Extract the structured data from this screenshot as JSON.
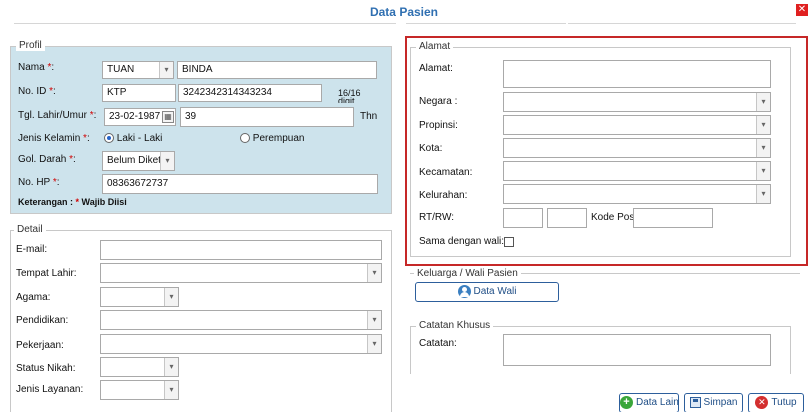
{
  "window": {
    "title": "Data Pasien"
  },
  "profil": {
    "legend": "Profil",
    "nama": {
      "label": "Nama",
      "gelar": "TUAN",
      "value": "BINDA"
    },
    "no_id": {
      "label": "No. ID",
      "type": "KTP",
      "value": "3242342314343234",
      "counter_1": "16/16",
      "counter_2": "digit"
    },
    "tgl_lahir": {
      "label": "Tgl. Lahir/Umur",
      "date": "23-02-1987",
      "umur": "39",
      "unit": "Thn"
    },
    "jenis_kelamin": {
      "label": "Jenis Kelamin",
      "option_1": "Laki - Laki",
      "option_2": "Perempuan",
      "selected": "Laki - Laki"
    },
    "gol_darah": {
      "label": "Gol. Darah",
      "value": "Belum Diketa"
    },
    "no_hp": {
      "label": "No. HP",
      "value": "08363672737"
    },
    "keterangan": {
      "prefix": "Keterangan : ",
      "star": "*",
      "text": " Wajib Diisi"
    },
    "required_mark": "*",
    "colon": ":"
  },
  "detail": {
    "legend": "Detail",
    "email": {
      "label": "E-mail:",
      "value": ""
    },
    "tempat_lahir": {
      "label": "Tempat Lahir:",
      "value": ""
    },
    "agama": {
      "label": "Agama:",
      "value": ""
    },
    "pendidikan": {
      "label": "Pendidikan:",
      "value": ""
    },
    "pekerjaan": {
      "label": "Pekerjaan:",
      "value": ""
    },
    "status_nikah": {
      "label": "Status Nikah:",
      "value": ""
    },
    "jenis_layanan": {
      "label": "Jenis Layanan:",
      "value": ""
    }
  },
  "alamat": {
    "legend": "Alamat",
    "alamat": {
      "label": "Alamat:",
      "value": ""
    },
    "negara": {
      "label": "Negara :",
      "value": ""
    },
    "propinsi": {
      "label": "Propinsi:",
      "value": ""
    },
    "kota": {
      "label": "Kota:",
      "value": ""
    },
    "kecamatan": {
      "label": "Kecamatan:",
      "value": ""
    },
    "kelurahan": {
      "label": "Kelurahan:",
      "value": ""
    },
    "rtrw": {
      "label": "RT/RW:",
      "rt": "",
      "rw": ""
    },
    "kode_pos": {
      "label": "Kode Pos",
      "value": ""
    },
    "sama_dengan_wali": {
      "label": "Sama dengan wali:",
      "checked": false
    }
  },
  "keluarga": {
    "legend": "Keluarga / Wali Pasien",
    "button": "Data Wali"
  },
  "catatan": {
    "legend": "Catatan Khusus",
    "label": "Catatan:",
    "value": ""
  },
  "footer": {
    "data_lain": "Data Lain",
    "simpan": "Simpan",
    "tutup": "Tutup"
  },
  "colors": {
    "title": "#2f6fb1",
    "profil_bg": "#cde3ec",
    "highlight": "#c62828",
    "button_border": "#2d5f9c"
  },
  "icons": {
    "close": "close-icon",
    "calendar": "calendar-icon",
    "dropdown": "chevron-down-icon",
    "user": "user-icon",
    "plus": "plus-circle-icon",
    "save": "save-icon",
    "cancel": "cancel-icon"
  }
}
